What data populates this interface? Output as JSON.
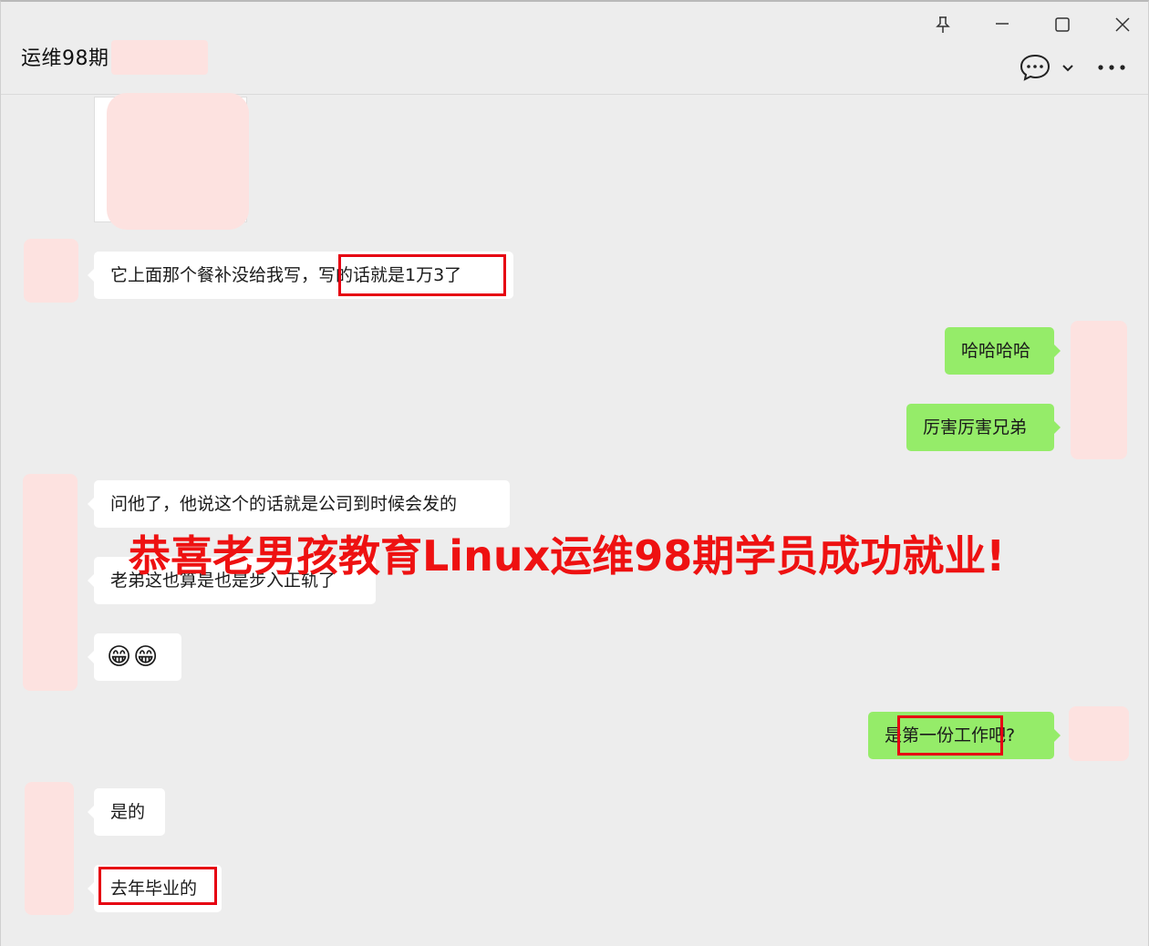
{
  "header": {
    "title": "运维98期",
    "icons": [
      "pin-icon",
      "minimize-icon",
      "maximize-icon",
      "close-icon",
      "chat-bubble-icon",
      "chevron-down-icon",
      "more-icon"
    ]
  },
  "messages": {
    "m1": "它上面那个餐补没给我写，写的话就是1万3了",
    "m2": "哈哈哈哈",
    "m3": "厉害厉害兄弟",
    "m4": "问他了，他说这个的话就是公司到时候会发的",
    "m5": "老弟这也算是也是步入正轨了",
    "m6": "😁😁",
    "m7": "是第一份工作吧?",
    "m8": "是的",
    "m9": "去年毕业的"
  },
  "overlay": {
    "banner": "恭喜老男孩教育Linux运维98期学员成功就业!"
  },
  "colors": {
    "background": "#ededed",
    "incoming_bubble": "#ffffff",
    "outgoing_bubble": "#95ec69",
    "highlight_box": "#e60012",
    "banner_text": "#ee1111",
    "redaction": "#fde2e0"
  }
}
